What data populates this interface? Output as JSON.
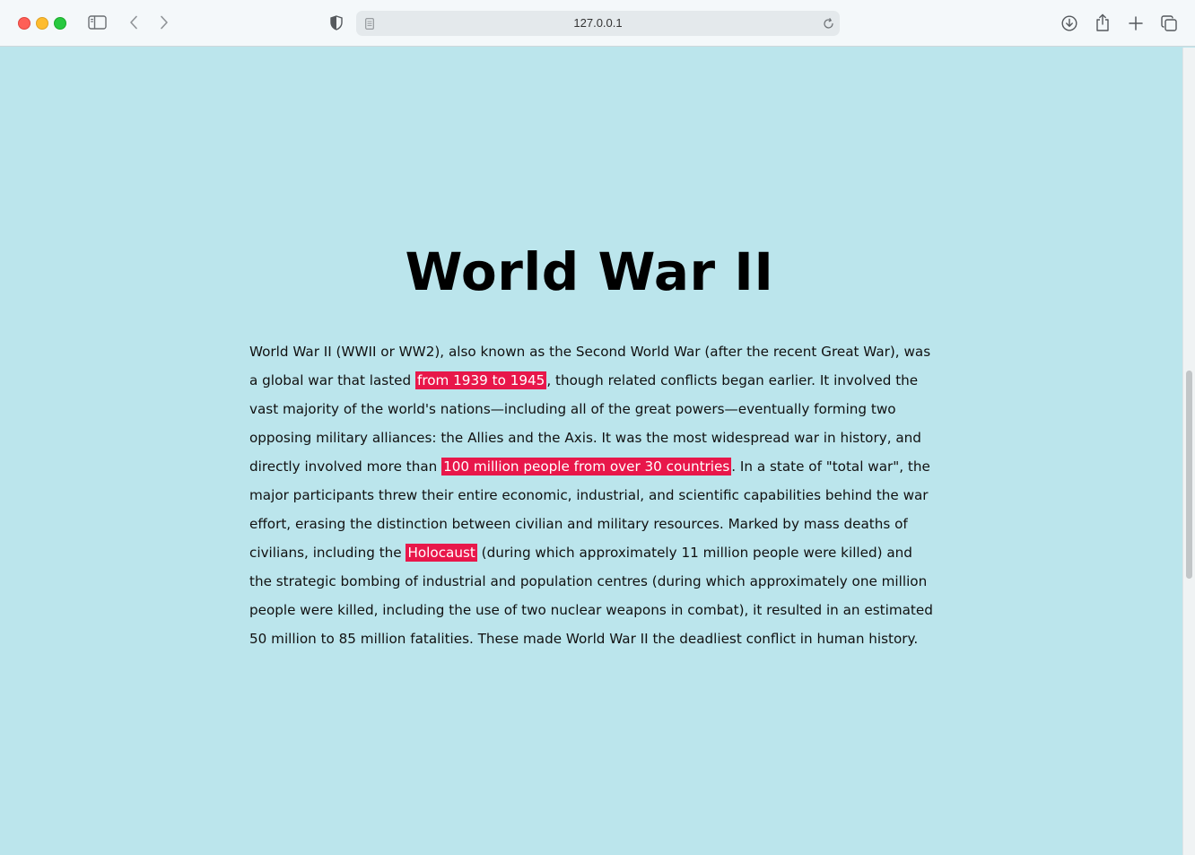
{
  "browser": {
    "url": "127.0.0.1",
    "icons": [
      "sidebar-icon",
      "back-icon",
      "forward-icon",
      "shield-icon",
      "page-icon",
      "reload-icon",
      "download-icon",
      "share-icon",
      "new-tab-icon",
      "tabs-overview-icon"
    ]
  },
  "colors": {
    "page_bg": "#bbe5ec",
    "highlight_bg": "#e8174a",
    "highlight_text": "#ffffff"
  },
  "article": {
    "title": "World War II",
    "seg1": "World War II (WWII or WW2), also known as the Second World War (after the recent Great War), was a global war that lasted ",
    "hl1": "from 1939 to 1945",
    "seg2": ", though related conflicts began earlier. It involved the vast majority of the world's nations—including all of the great powers—eventually forming two opposing military alliances: the Allies and the Axis. It was the most widespread war in history, and directly involved more than ",
    "hl2": "100 million people from over 30 countries",
    "seg3": ". In a state of \"total war\", the major participants threw their entire economic, industrial, and scientific capabilities behind the war effort, erasing the distinction between civilian and military resources. Marked by mass deaths of civilians, including the ",
    "hl3": "Holocaust",
    "seg4": " (during which approximately 11 million people were killed) and the strategic bombing of industrial and population centres (during which approximately one million people were killed, including the use of two nuclear weapons in combat), it resulted in an estimated 50 million to 85 million fatalities. These made World War II the deadliest conflict in human history."
  }
}
